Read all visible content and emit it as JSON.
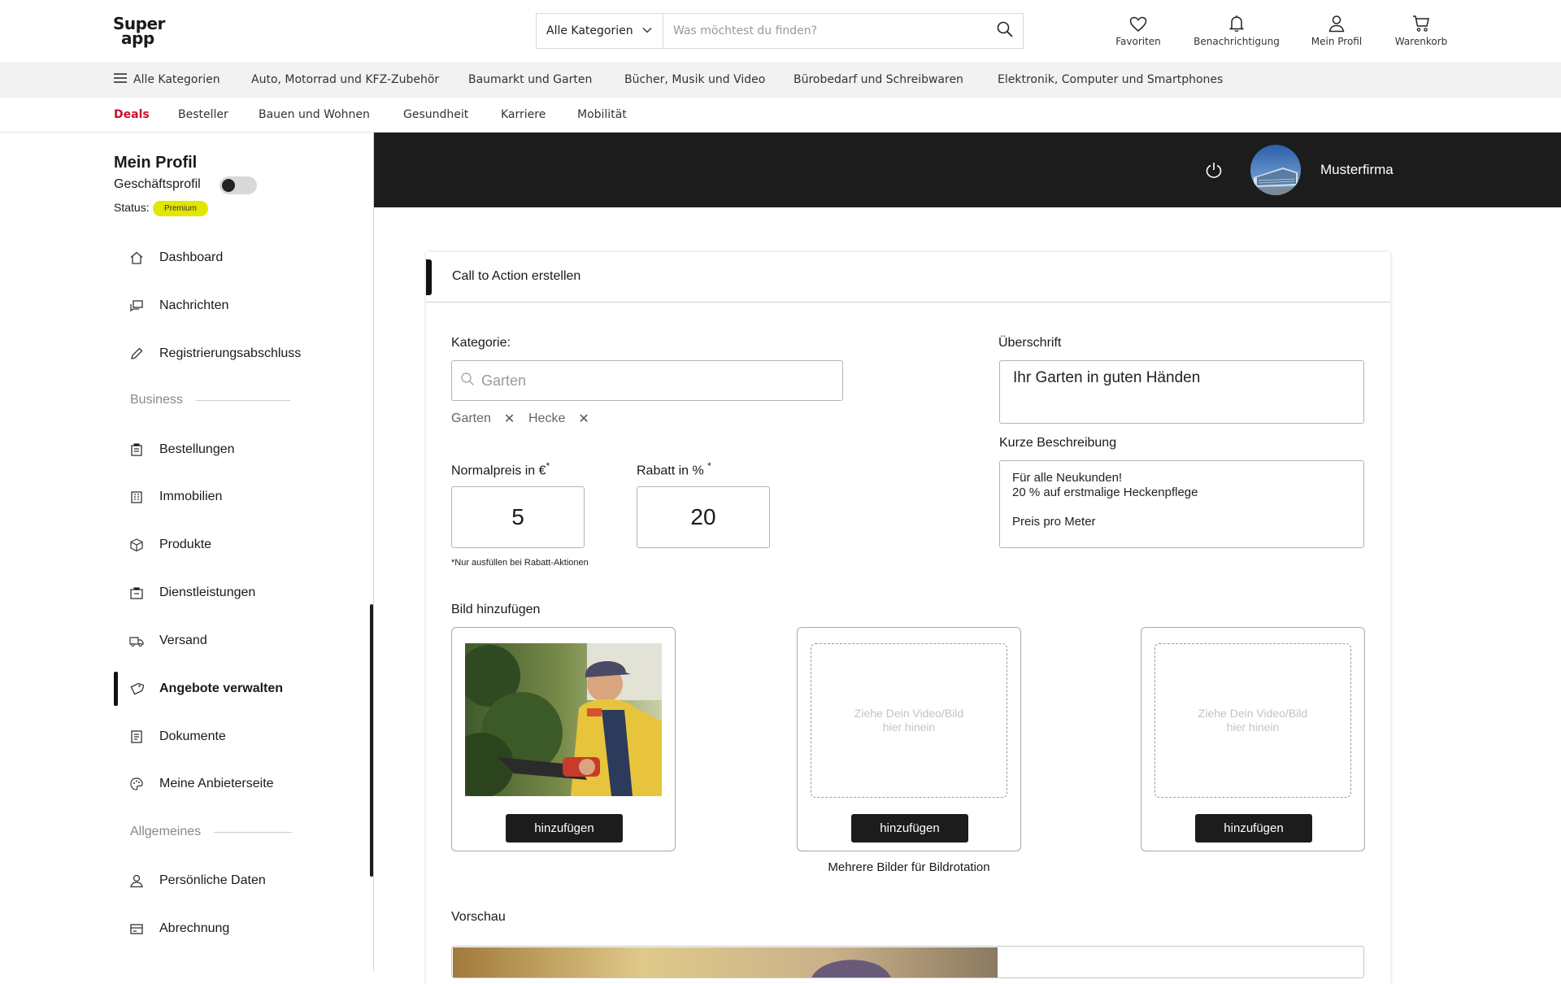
{
  "header": {
    "logo_line1": "Super",
    "logo_line2": "app",
    "category_select": "Alle Kategorien",
    "search_placeholder": "Was möchtest du finden?",
    "actions": {
      "favorites": "Favoriten",
      "notifications": "Benachrichtigung",
      "profile": "Mein Profil",
      "cart": "Warenkorb"
    }
  },
  "category_bar": {
    "all": "Alle Kategorien",
    "items": [
      "Auto, Motorrad und KFZ-Zubehör",
      "Baumarkt und Garten",
      "Bücher, Musik und Video",
      "Bürobedarf und Schreibwaren",
      "Elektronik, Computer und Smartphones"
    ]
  },
  "sub_bar": {
    "items": [
      "Deals",
      "Besteller",
      "Bauen und Wohnen",
      "Gesundheit",
      "Karriere",
      "Mobilität"
    ],
    "active": "Deals",
    "active_color": "#c8102e"
  },
  "sidebar": {
    "title": "Mein Profil",
    "business_profile_label": "Geschäftsprofil",
    "status_label": "Status:",
    "status_badge": "Premium",
    "status_color": "#e3e600",
    "items": [
      {
        "label": "Dashboard",
        "icon": "home-icon"
      },
      {
        "label": "Nachrichten",
        "icon": "messages-icon"
      },
      {
        "label": "Registrierungsabschluss",
        "icon": "pencil-icon"
      }
    ],
    "section_business": "Business",
    "business_items": [
      {
        "label": "Bestellungen",
        "icon": "orders-icon"
      },
      {
        "label": "Immobilien",
        "icon": "building-icon"
      },
      {
        "label": "Produkte",
        "icon": "box-icon"
      },
      {
        "label": "Dienstleistungen",
        "icon": "briefcase-icon"
      },
      {
        "label": "Versand",
        "icon": "truck-icon"
      },
      {
        "label": "Angebote verwalten",
        "icon": "tag-icon",
        "active": true
      },
      {
        "label": "Dokumente",
        "icon": "document-icon"
      },
      {
        "label": "Meine Anbieterseite",
        "icon": "palette-icon"
      }
    ],
    "section_general": "Allgemeines",
    "general_items": [
      {
        "label": "Persönliche Daten",
        "icon": "user-icon"
      },
      {
        "label": "Abrechnung",
        "icon": "billing-icon"
      }
    ]
  },
  "topbar": {
    "company_name": "Musterfirma"
  },
  "form": {
    "title": "Call to Action erstellen",
    "category_label": "Kategorie:",
    "category_placeholder": "Garten",
    "tags": [
      "Garten",
      "Hecke"
    ],
    "tag_remove": "✕",
    "normal_price_label": "Normalpreis in €",
    "discount_label": "Rabatt in %",
    "required_mark": "*",
    "normal_price_value": "5",
    "discount_value": "20",
    "note": "*Nur ausfüllen bei Rabatt-Aktionen",
    "headline_label": "Überschrift",
    "headline_value": "Ihr Garten in guten Händen",
    "short_desc_label": "Kurze Beschreibung",
    "short_desc_line1": "Für alle Neukunden!",
    "short_desc_line2": "20 % auf erstmalige Heckenpflege",
    "short_desc_line3": "Preis pro Meter",
    "add_image_label": "Bild hinzufügen",
    "dropzone_text": "Ziehe Dein Video/Bild hier hinein",
    "add_button": "hinzufügen",
    "rotation_caption": "Mehrere Bilder für Bildrotation",
    "preview_label": "Vorschau"
  }
}
